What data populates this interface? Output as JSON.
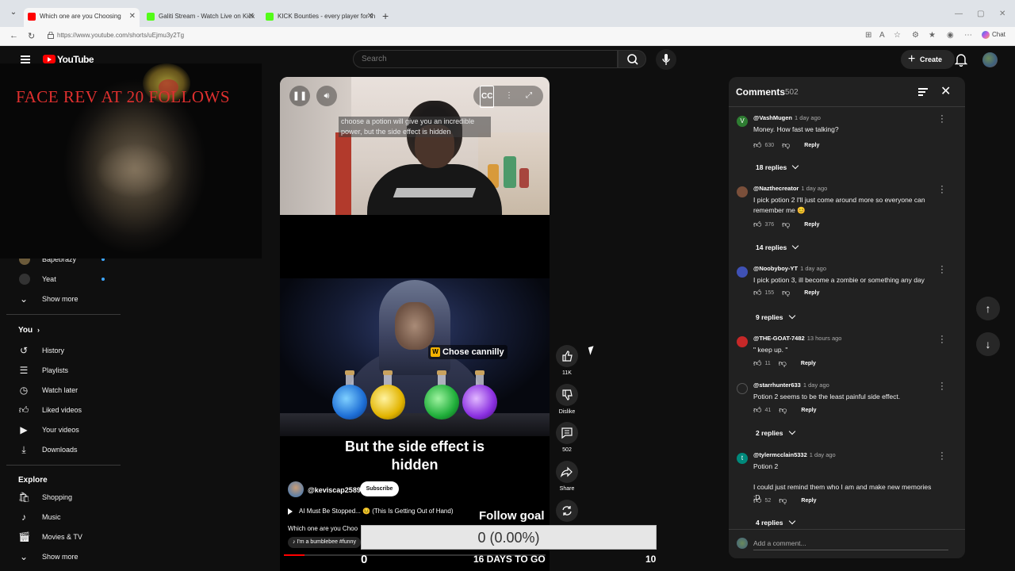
{
  "browser": {
    "tabs": [
      {
        "title": "Which one are you Choosing",
        "active": true
      },
      {
        "title": "Galiti Stream - Watch Live on Kick",
        "active": false
      },
      {
        "title": "KICK Bounties - every player for th",
        "active": false
      }
    ],
    "url": "https://www.youtube.com/shorts/uEjmu3y2Tg",
    "chat_label": "Chat"
  },
  "header": {
    "logo_text": "YouTube",
    "search_placeholder": "Search",
    "create_label": "Create"
  },
  "webcam": {
    "overlay_text": "FACE REV AT 20 FOLLOWS"
  },
  "sidebar": {
    "subscriptions": [
      {
        "label": "Bapebrazy",
        "new": true
      },
      {
        "label": "Yeat",
        "new": true
      }
    ],
    "show_more_1": "Show more",
    "you_heading": "You",
    "you_items": [
      {
        "label": "History",
        "icon": "history-icon"
      },
      {
        "label": "Playlists",
        "icon": "playlists-icon"
      },
      {
        "label": "Watch later",
        "icon": "watch-later-icon"
      },
      {
        "label": "Liked videos",
        "icon": "liked-videos-icon"
      },
      {
        "label": "Your videos",
        "icon": "your-videos-icon"
      },
      {
        "label": "Downloads",
        "icon": "downloads-icon"
      }
    ],
    "explore_heading": "Explore",
    "explore_items": [
      {
        "label": "Shopping",
        "icon": "shopping-icon"
      },
      {
        "label": "Music",
        "icon": "music-icon"
      },
      {
        "label": "Movies & TV",
        "icon": "movies-icon"
      }
    ],
    "show_more_2": "Show more"
  },
  "video": {
    "caption_text": "choose a potion will give you an incredible power, but the side effect is hidden",
    "overlay_badge": "Chose cannilly",
    "big_caption": "But the side effect is hidden",
    "channel": "@keviscap2589",
    "subscribe_label": "Subscribe",
    "music_title": "AI Must Be Stopped... 😣 (This Is Getting Out of Hand)",
    "description": "Which one are you Choo",
    "sound": "I'm a bumblebee #funny",
    "progress": 0.08
  },
  "actions": {
    "likes": "11K",
    "dislike_label": "Dislike",
    "comments_count": "502",
    "share_label": "Share"
  },
  "follow_goal": {
    "title": "Follow goal",
    "progress_text": "0 (0.00%)",
    "min": "0",
    "days_text": "16 DAYS TO GO",
    "max": "10"
  },
  "comments": {
    "title": "Comments",
    "count": "502",
    "items": [
      {
        "author": "@VashMugen",
        "time": "1 day ago",
        "text": "Money.  How fast we talking?",
        "likes": "630",
        "replies": "18 replies",
        "avatar_letter": "V",
        "avatar_color": "#2e7d32"
      },
      {
        "author": "@Nazthecreator",
        "time": "1 day ago",
        "text": "I pick potion 2 I'll just come around more so everyone can remember me 😊",
        "likes": "376",
        "replies": "14 replies",
        "avatar_letter": "",
        "avatar_color": "#7a4f3a"
      },
      {
        "author": "@Noobyboy-YT",
        "time": "1 day ago",
        "text": "I pick potion 3, ill become a zombie or something any day",
        "likes": "155",
        "replies": "9 replies",
        "avatar_letter": "",
        "avatar_color": "#3f51b5"
      },
      {
        "author": "@THE-GOAT-7482",
        "time": "13 hours ago",
        "text": "\" keep up. \"",
        "likes": "11",
        "replies": "",
        "avatar_letter": "",
        "avatar_color": "#c62828"
      },
      {
        "author": "@starrhunter633",
        "time": "1 day ago",
        "text": "Potion 2 seems to be the least painful side effect.",
        "likes": "41",
        "replies": "2 replies",
        "avatar_letter": "",
        "avatar_color": "#222222"
      },
      {
        "author": "@tylermcclain5332",
        "time": "1 day ago",
        "text": "Potion 2\n\nI could just remind them who I am and make new memories :D",
        "likes": "52",
        "replies": "4 replies",
        "avatar_letter": "t",
        "avatar_color": "#00897b"
      }
    ],
    "reply_label": "Reply",
    "add_placeholder": "Add a comment..."
  }
}
